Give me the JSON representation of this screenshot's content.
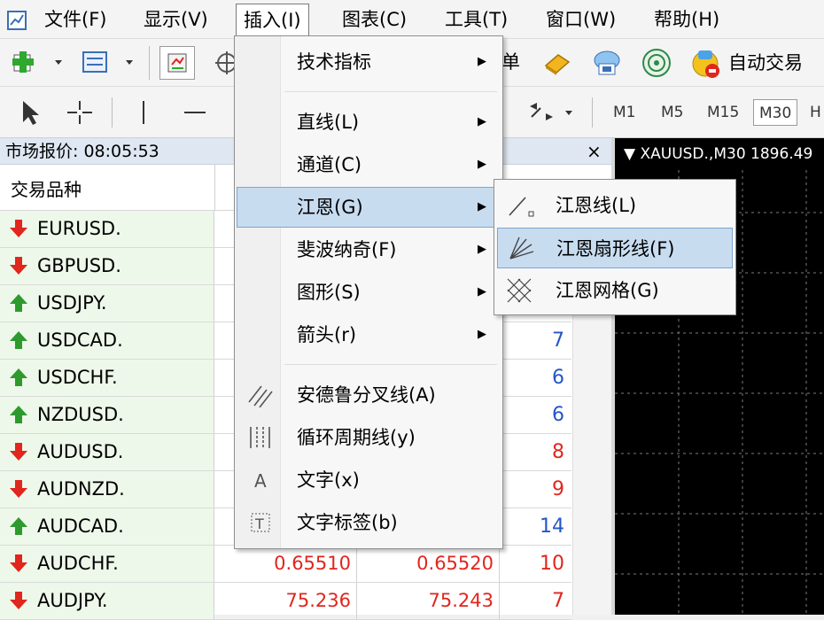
{
  "menubar": {
    "items": [
      "文件(F)",
      "显示(V)",
      "插入(I)",
      "图表(C)",
      "工具(T)",
      "窗口(W)",
      "帮助(H)"
    ]
  },
  "toolbar": {
    "partial_label": "单",
    "auto_trade_label": "自动交易",
    "timeframes": [
      "M1",
      "M5",
      "M15",
      "M30",
      "H"
    ]
  },
  "market_watch": {
    "title": "市场报价: 08:05:53",
    "close": "×",
    "column_symbol": "交易品种",
    "rows": [
      {
        "symbol": "EURUSD.",
        "dir": "down",
        "bid": "",
        "ask": "",
        "spread": "",
        "spread_color": "blue"
      },
      {
        "symbol": "GBPUSD.",
        "dir": "down",
        "bid": "",
        "ask": "",
        "spread": "",
        "spread_color": "blue"
      },
      {
        "symbol": "USDJPY.",
        "dir": "up",
        "bid": "",
        "ask": "",
        "spread": "",
        "spread_color": "blue"
      },
      {
        "symbol": "USDCAD.",
        "dir": "up",
        "bid": "",
        "ask": "",
        "spread": "7",
        "spread_color": "blue"
      },
      {
        "symbol": "USDCHF.",
        "dir": "up",
        "bid": "",
        "ask": "",
        "spread": "6",
        "spread_color": "blue"
      },
      {
        "symbol": "NZDUSD.",
        "dir": "up",
        "bid": "",
        "ask": "",
        "spread": "6",
        "spread_color": "blue"
      },
      {
        "symbol": "AUDUSD.",
        "dir": "down",
        "bid": "",
        "ask": "",
        "spread": "8",
        "spread_color": "red"
      },
      {
        "symbol": "AUDNZD.",
        "dir": "down",
        "bid": "",
        "ask": "",
        "spread": "9",
        "spread_color": "red"
      },
      {
        "symbol": "AUDCAD.",
        "dir": "up",
        "bid": "",
        "ask": "",
        "spread": "14",
        "spread_color": "blue"
      },
      {
        "symbol": "AUDCHF.",
        "dir": "down",
        "bid": "0.65510",
        "ask": "0.65520",
        "spread": "10",
        "spread_color": "red"
      },
      {
        "symbol": "AUDJPY.",
        "dir": "down",
        "bid": "75.236",
        "ask": "75.243",
        "spread": "7",
        "spread_color": "red"
      }
    ]
  },
  "chart": {
    "header": "XAUUSD.,M30  1896.49"
  },
  "insert_menu": {
    "items": [
      {
        "label": "技术指标",
        "submenu": true
      },
      {
        "label": "直线(L)",
        "submenu": true
      },
      {
        "label": "通道(C)",
        "submenu": true
      },
      {
        "label": "江恩(G)",
        "submenu": true,
        "highlighted": true
      },
      {
        "label": "斐波纳奇(F)",
        "submenu": true
      },
      {
        "label": "图形(S)",
        "submenu": true
      },
      {
        "label": "箭头(r)",
        "submenu": true
      },
      {
        "label": "安德鲁分叉线(A)",
        "icon": "andrews-pitchfork-icon"
      },
      {
        "label": "循环周期线(y)",
        "icon": "cycle-lines-icon"
      },
      {
        "label": "文字(x)",
        "icon": "text-icon"
      },
      {
        "label": "文字标签(b)",
        "icon": "text-label-icon"
      }
    ],
    "submenu_arrow": "▶"
  },
  "gann_submenu": {
    "items": [
      {
        "label": "江恩线(L)",
        "icon": "gann-line-icon"
      },
      {
        "label": "江恩扇形线(F)",
        "icon": "gann-fan-icon",
        "highlighted": true
      },
      {
        "label": "江恩网格(G)",
        "icon": "gann-grid-icon"
      }
    ]
  },
  "colors": {
    "menu_highlight": "#c8dcf0",
    "price_red": "#e0261d",
    "spread_blue": "#2356c8",
    "up_green": "#2e9a2e",
    "down_red": "#e0261d",
    "symbol_bg": "#eef8ea"
  }
}
